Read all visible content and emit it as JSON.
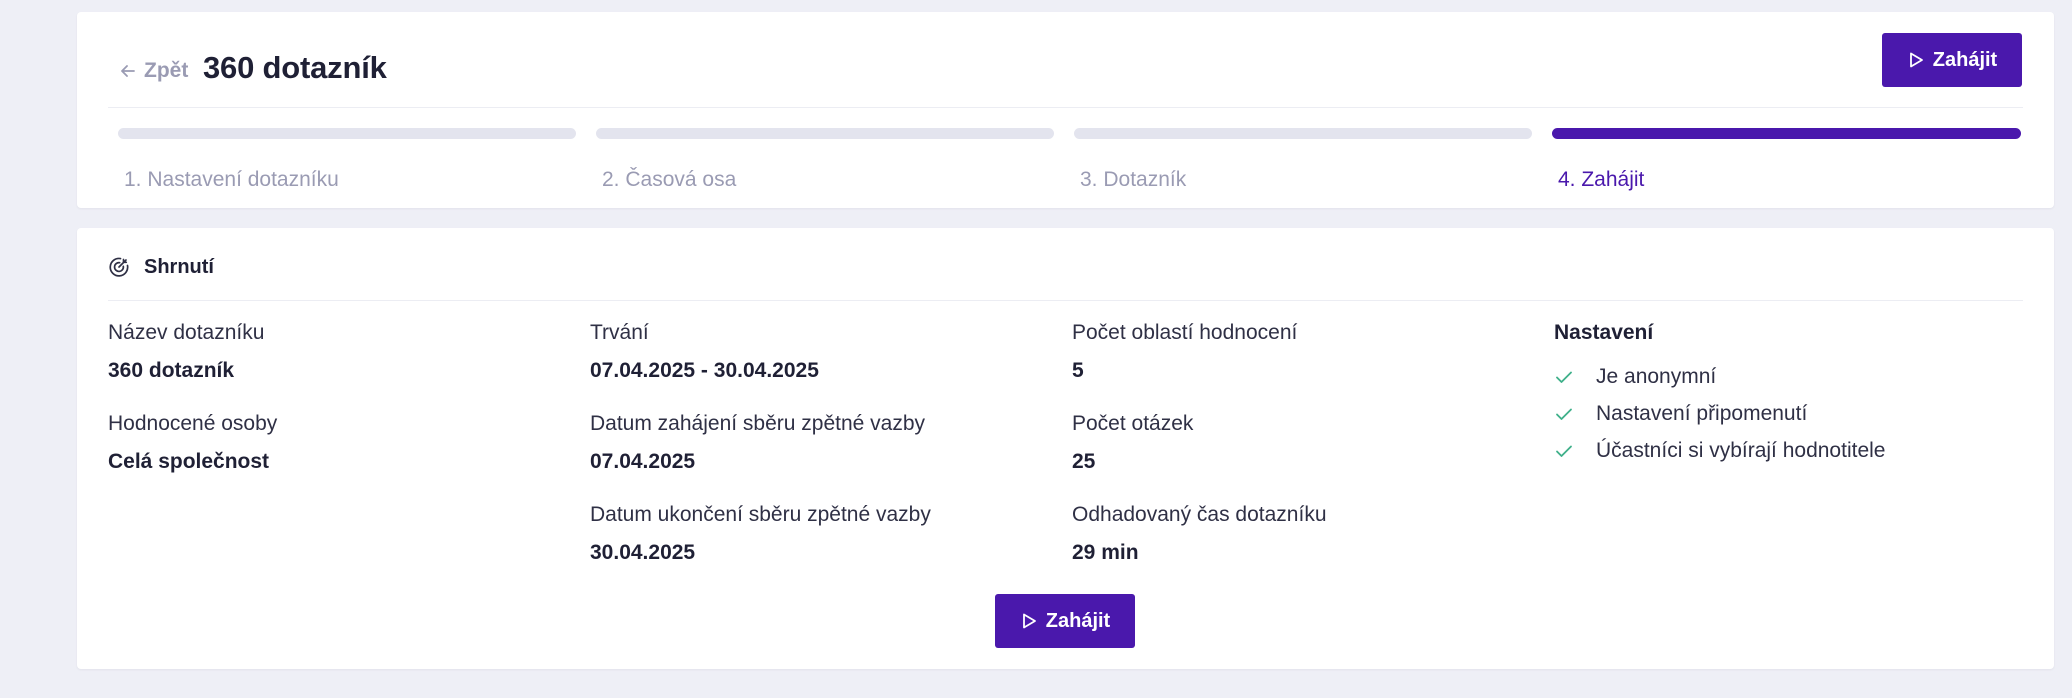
{
  "header": {
    "back_label": "Zpět",
    "title": "360 dotazník",
    "start_button_label": "Zahájit"
  },
  "stepper": {
    "steps": [
      {
        "label": "1. Nastavení dotazníku",
        "active": false
      },
      {
        "label": "2. Časová osa",
        "active": false
      },
      {
        "label": "3. Dotazník",
        "active": false
      },
      {
        "label": "4. Zahájit",
        "active": true
      }
    ]
  },
  "summary": {
    "title": "Shrnutí",
    "icon": "target-icon",
    "columns": [
      [
        {
          "label": "Název dotazníku",
          "value": "360 dotazník"
        },
        {
          "label": "Hodnocené osoby",
          "value": "Celá společnost"
        }
      ],
      [
        {
          "label": "Trvání",
          "value": "07.04.2025 - 30.04.2025"
        },
        {
          "label": "Datum zahájení sběru zpětné vazby",
          "value": "07.04.2025"
        },
        {
          "label": "Datum ukončení sběru zpětné vazby",
          "value": "30.04.2025"
        }
      ],
      [
        {
          "label": "Počet oblastí hodnocení",
          "value": "5"
        },
        {
          "label": "Počet otázek",
          "value": "25"
        },
        {
          "label": "Odhadovaný čas dotazníku",
          "value": "29 min"
        }
      ]
    ],
    "settings": {
      "title": "Nastavení",
      "items": [
        "Je anonymní",
        "Nastavení připomenutí",
        "Účastníci si vybírají hodnotitele"
      ]
    },
    "start_button_label": "Zahájit"
  },
  "colors": {
    "primary": "#4a18ac",
    "check": "#3fb08a",
    "muted": "#9a9bb3",
    "background": "#eeeff6"
  }
}
